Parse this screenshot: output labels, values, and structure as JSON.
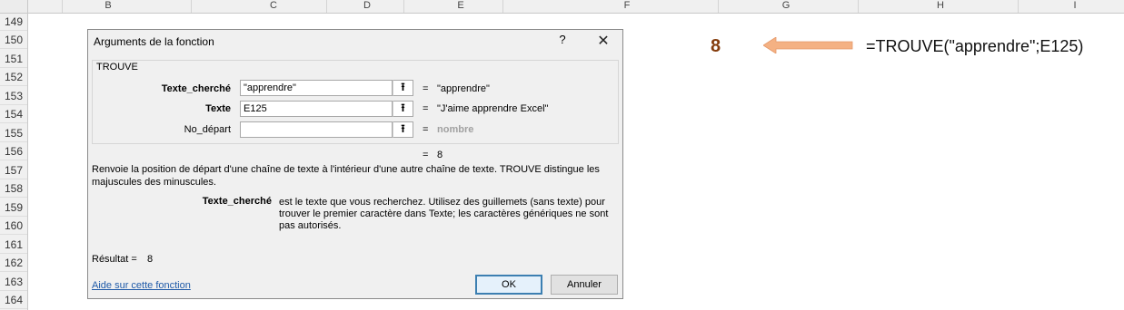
{
  "columns": [
    "B",
    "C",
    "D",
    "E",
    "F",
    "G",
    "H",
    "I"
  ],
  "rows": [
    "149",
    "150",
    "151",
    "152",
    "153",
    "154",
    "155",
    "156",
    "157",
    "158",
    "159",
    "160",
    "161",
    "162",
    "163",
    "164"
  ],
  "sheet": {
    "result_value": "8",
    "formula": "=TROUVE(\"apprendre\";E125)",
    "arrow_color": "#f4b183"
  },
  "dialog": {
    "title": "Arguments de la fonction",
    "help_glyph": "?",
    "close_glyph": "✕",
    "function_name": "TROUVE",
    "args": [
      {
        "label": "Texte_cherché",
        "value": "\"apprendre\"",
        "result": "\"apprendre\""
      },
      {
        "label": "Texte",
        "value": "E125",
        "result": "\"J'aime apprendre Excel\""
      },
      {
        "label": "No_départ",
        "value": "",
        "result": "nombre"
      }
    ],
    "eq": "=",
    "formula_result": "8",
    "description": "Renvoie la position de départ d'une chaîne de texte à l'intérieur d'une autre chaîne de texte. TROUVE distingue les majuscules des minuscules.",
    "param_name": "Texte_cherché",
    "param_description": "est le texte que vous recherchez. Utilisez des guillemets (sans texte) pour trouver le premier caractère dans Texte; les caractères génériques ne sont pas autorisés.",
    "result_label": "Résultat =",
    "result_value": "8",
    "help_link": "Aide sur cette fonction",
    "ok_label": "OK",
    "cancel_label": "Annuler"
  }
}
